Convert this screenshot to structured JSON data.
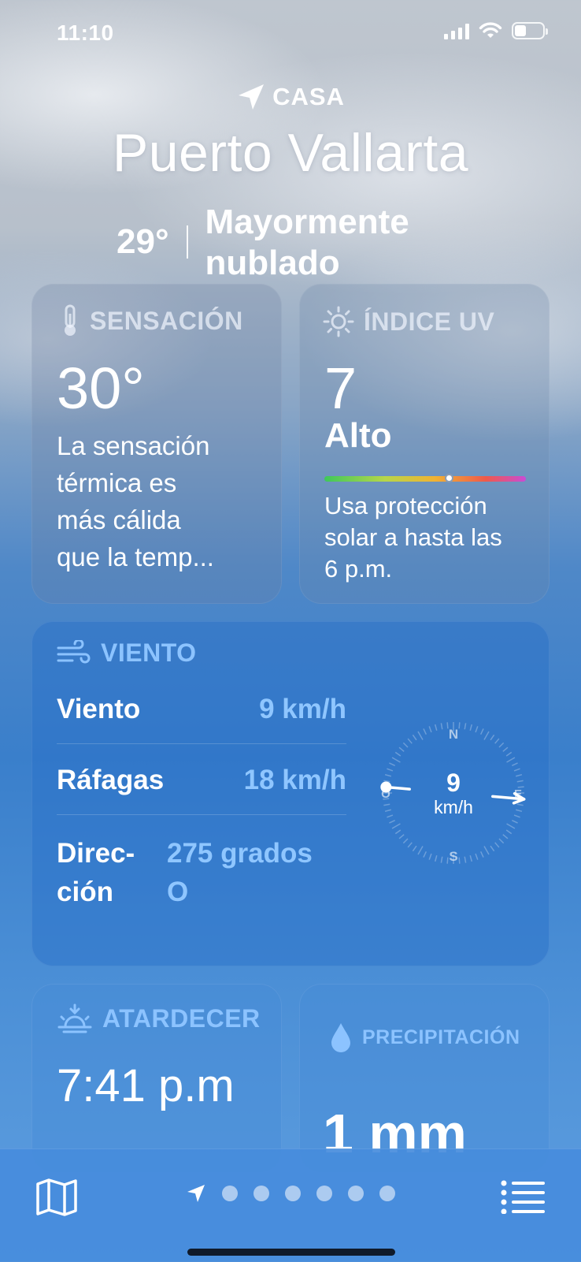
{
  "status_bar": {
    "time": "11:10",
    "signal_bars": 4,
    "battery_level": 0.3
  },
  "header": {
    "location_label": "CASA",
    "city": "Puerto Vallarta",
    "current_temp": "29°",
    "condition": "Mayormente nublado"
  },
  "feels_like": {
    "title": "SENSACIÓN",
    "value": "30°",
    "lines": [
      "La sensación",
      "térmica es",
      "más cálida",
      "que la temp..."
    ]
  },
  "uv_index": {
    "title": "ÍNDICE UV",
    "value": "7",
    "level": "Alto",
    "scale_position": 0.62,
    "lines": [
      "Usa protección",
      "solar a hasta las",
      "6 p.m."
    ]
  },
  "wind": {
    "title": "VIENTO",
    "rows": [
      {
        "label": "Viento",
        "value": "9 km/h"
      },
      {
        "label": "Ráfagas",
        "value": "18 km/h"
      },
      {
        "label_lines": [
          "Direc-",
          "ción"
        ],
        "value_lines": [
          "275 grados",
          "O"
        ]
      }
    ],
    "compass": {
      "speed": "9",
      "unit": "km/h",
      "n": "N",
      "e": "E",
      "s": "S",
      "w": "O",
      "direction_degrees": 275
    }
  },
  "sunset": {
    "title": "ATARDECER",
    "value": "7:41 p.m"
  },
  "precipitation": {
    "title": "PRECIPITACIÓN",
    "value": "1 mm"
  },
  "bottom_bar": {
    "page_count": 6,
    "icons": [
      "map-icon",
      "location-arrow-icon",
      "list-icon"
    ]
  },
  "colors": {
    "accent_value": "#8fc6ff",
    "title_blue": "#8cc3ff"
  }
}
